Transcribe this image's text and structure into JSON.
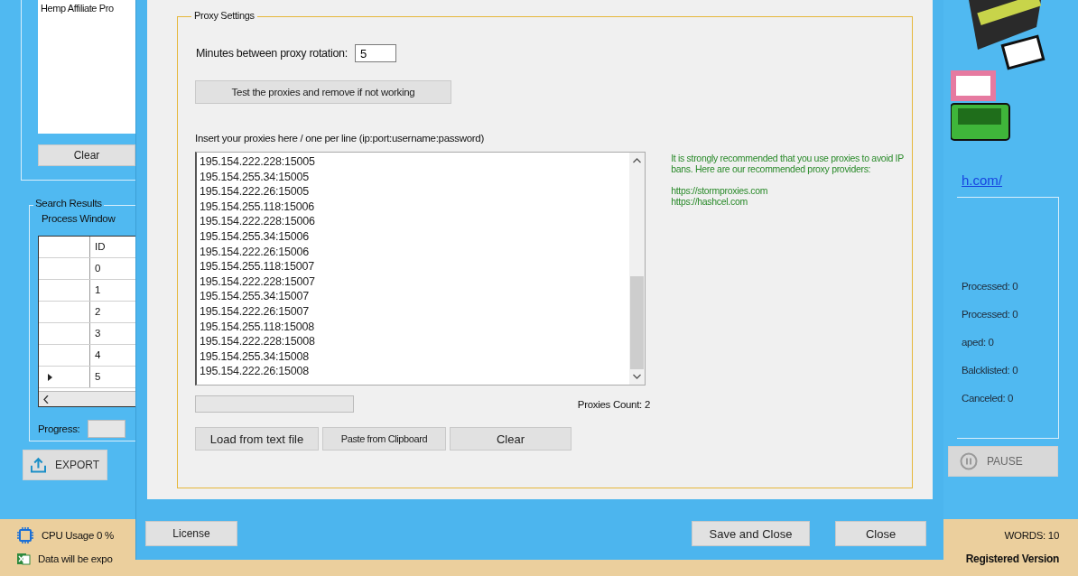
{
  "background_app": {
    "left_panel": {
      "keywords_list": [
        "Hemp Affiliate Pro"
      ],
      "clear_button": "Clear",
      "search_results": {
        "title": "Search Results",
        "process_window": "Process Window",
        "table": {
          "columns": [
            "ID"
          ],
          "rows": [
            {
              "id": "0",
              "current": false
            },
            {
              "id": "1",
              "current": false
            },
            {
              "id": "2",
              "current": false
            },
            {
              "id": "3",
              "current": false
            },
            {
              "id": "4",
              "current": false
            },
            {
              "id": "5",
              "current": true
            }
          ]
        },
        "progress_label": "Progress:",
        "progress": {
          "level": 0
        }
      },
      "export_button": "EXPORT"
    },
    "right_panel": {
      "link": "h.com/",
      "counters": [
        "Processed: 0",
        "Processed: 0",
        "aped: 0",
        "Balcklisted: 0",
        "Canceled: 0"
      ],
      "pause_button": "PAUSE"
    },
    "status_bar": {
      "cpu": "CPU Usage 0 %",
      "export_path": "Data will be expo",
      "keywords": "WORDS: 10",
      "registration": "Registered Version"
    }
  },
  "dialog": {
    "proxy_settings": {
      "title": "Proxy Settings",
      "rotation_label": "Minutes between proxy rotation:",
      "rotation_value": "5",
      "test_button": "Test the proxies and remove if not working",
      "list_label": "Insert your proxies here / one per line (ip:port:username:password)",
      "proxies": [
        "195.154.222.228:15005",
        "195.154.255.34:15005",
        "195.154.222.26:15005",
        "195.154.255.118:15006",
        "195.154.222.228:15006",
        "195.154.255.34:15006",
        "195.154.222.26:15006",
        "195.154.255.118:15007",
        "195.154.222.228:15007",
        "195.154.255.34:15007",
        "195.154.222.26:15007",
        "195.154.255.118:15008",
        "195.154.222.228:15008",
        "195.154.255.34:15008",
        "195.154.222.26:15008"
      ],
      "note": "It is strongly recommended that you use proxies to avoid IP bans. Here are our recommended proxy providers:",
      "providers": [
        "https://stormproxies.com",
        "https://hashcel.com"
      ],
      "test_progress": {
        "level": 0
      },
      "count": "Proxies Count: 2",
      "buttons": [
        "Load from text file",
        "Paste from Clipboard",
        "Clear"
      ]
    },
    "footer_buttons": {
      "left": [
        "License"
      ],
      "right": [
        "Save and Close",
        "Close"
      ]
    }
  }
}
